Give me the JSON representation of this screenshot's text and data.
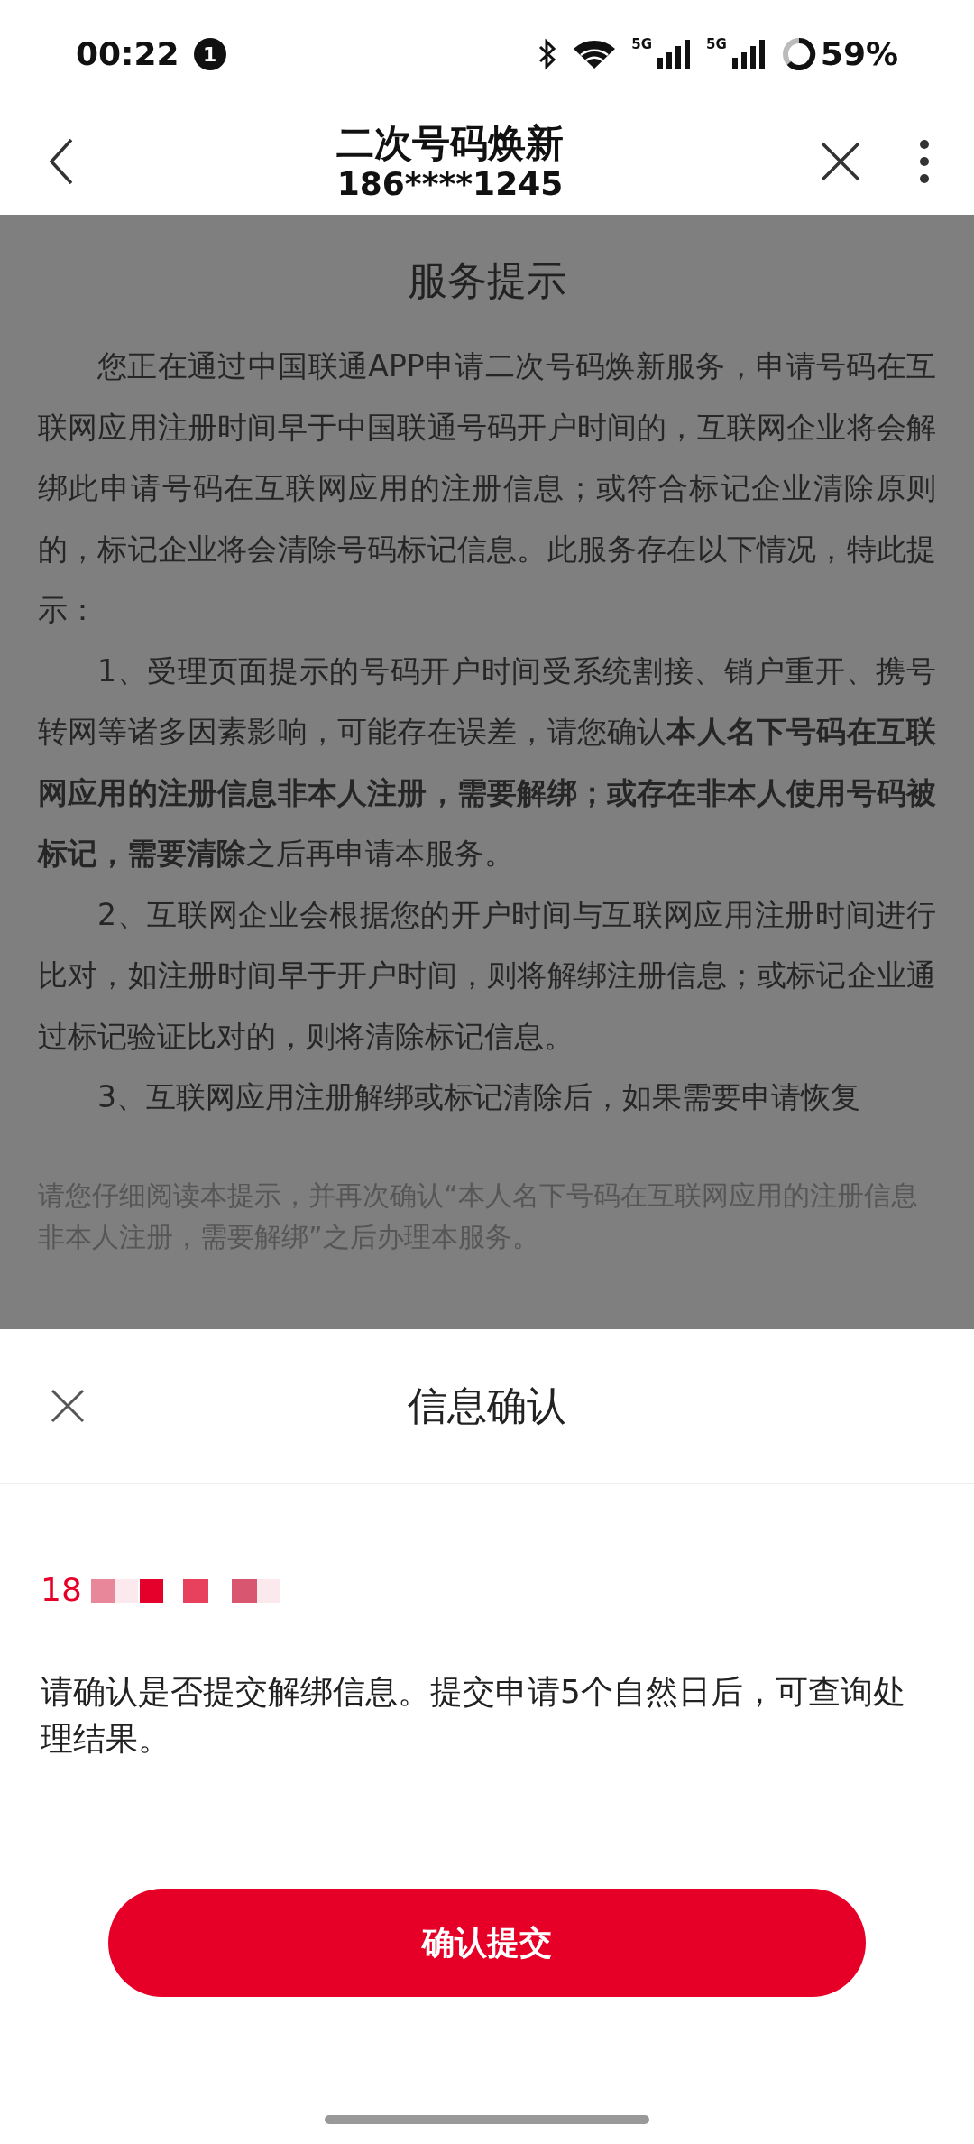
{
  "status_bar": {
    "time": "00:22",
    "notification_count": "1",
    "network_labels": [
      "5G",
      "5G"
    ],
    "battery": "59%"
  },
  "header": {
    "title": "二次号码焕新",
    "subtitle": "186****1245"
  },
  "service_notice": {
    "title": "服务提示",
    "paragraphs": [
      "您正在通过中国联通APP申请二次号码焕新服务，申请号码在互联网应用注册时间早于中国联通号码开户时间的，互联网企业将会解绑此申请号码在互联网应用的注册信息；或符合标记企业清除原则的，标记企业将会清除号码标记信息。此服务存在以下情况，特此提示：",
      "1、受理页面提示的号码开户时间受系统割接、销户重开、携号转网等诸多因素影响，可能存在误差，请您确认**本人名下号码在互联网应用的注册信息非本人注册，需要解绑；或存在非本人使用号码被标记，需要清除**之后再申请本服务。",
      "2、互联网企业会根据您的开户时间与互联网应用注册时间进行比对，如注册时间早于开户时间，则将解绑注册信息；或标记企业通过标记验证比对的，则将清除标记信息。",
      "3、互联网应用注册解绑或标记清除后，如果需要申请恢复"
    ],
    "footer_note": "请您仔细阅读本提示，并再次确认“本人名下号码在互联网应用的注册信息非本人注册，需要解绑”之后办理本服务。"
  },
  "confirm_sheet": {
    "title": "信息确认",
    "phone_prefix": "18",
    "message": "请确认是否提交解绑信息。提交申请5个自然日后，可查询处理结果。",
    "submit_button": "确认提交"
  }
}
